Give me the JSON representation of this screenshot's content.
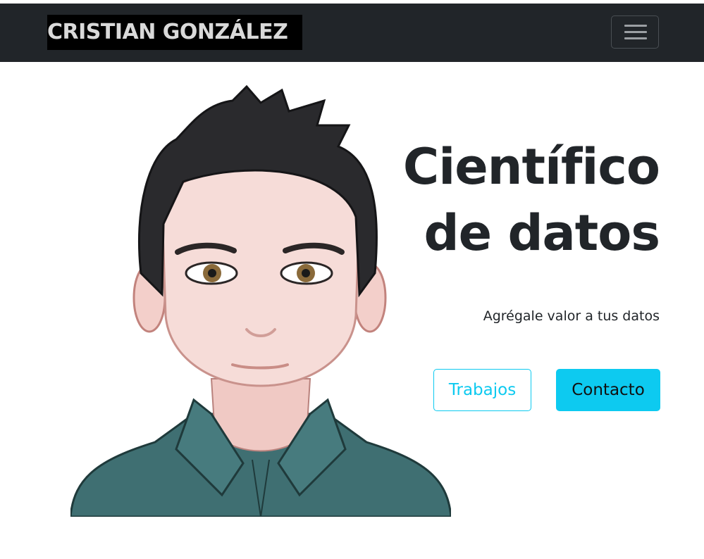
{
  "navbar": {
    "brand": "CRISTIAN GONZÁLEZ",
    "toggler_icon": "hamburger-menu-icon",
    "background": "#212529"
  },
  "hero": {
    "title_line1": "Científico",
    "title_line2": "de datos",
    "subtitle": "Agrégale valor a tus datos",
    "illustration": "cartoon-avatar-man"
  },
  "buttons": {
    "works_label": "Trabajos",
    "contact_label": "Contacto",
    "accent_color": "#0dcaf0"
  }
}
